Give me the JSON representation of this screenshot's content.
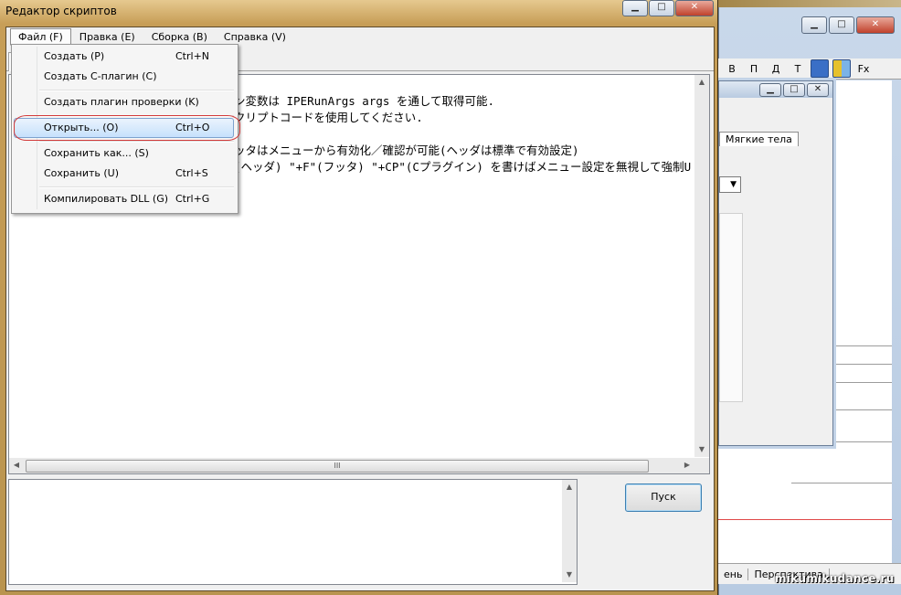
{
  "window": {
    "title": "Редактор скриптов"
  },
  "menubar": {
    "items": [
      {
        "label": "Файл (F)"
      },
      {
        "label": "Правка (E)"
      },
      {
        "label": "Сборка (B)"
      },
      {
        "label": "Справка (V)"
      }
    ]
  },
  "file_menu": {
    "items": [
      {
        "label": "Создать (P)",
        "shortcut": "Ctrl+N"
      },
      {
        "label": "Создать С-плагин (C)",
        "shortcut": ""
      },
      {
        "label": "Создать плагин проверки (K)",
        "shortcut": ""
      },
      {
        "label": "Открыть... (O)",
        "shortcut": "Ctrl+O",
        "highlighted": true
      },
      {
        "label": "Сохранить как... (S)",
        "shortcut": ""
      },
      {
        "label": "Сохранить (U)",
        "shortcut": "Ctrl+S"
      },
      {
        "label": "Компилировать DLL (G)",
        "shortcut": "Ctrl+G"
      }
    ]
  },
  "editor": {
    "lines": [
      "",
      "ン変数は IPERunArgs args を通して取得可能.",
      "クリプトコードを使用してください.",
      "",
      "ッタはメニューから有効化／確認が可能(ヘッダは標準で有効設定)",
      "(ヘッダ) \"+F\"(フッタ) \"+CP\"(Cプラグイン) を書けばメニュー設定を無視して強制U"
    ],
    "hscroll_grip": "III"
  },
  "run_button": {
    "label": "Пуск"
  },
  "background": {
    "toolbar": [
      "В",
      "П",
      "Д",
      "Т"
    ],
    "toolbar_fx": "Fx",
    "panel_tab": "Мягкие тела",
    "status_items": [
      "ень",
      "Перспектива"
    ],
    "watermark": "mikumikudance.ru"
  }
}
